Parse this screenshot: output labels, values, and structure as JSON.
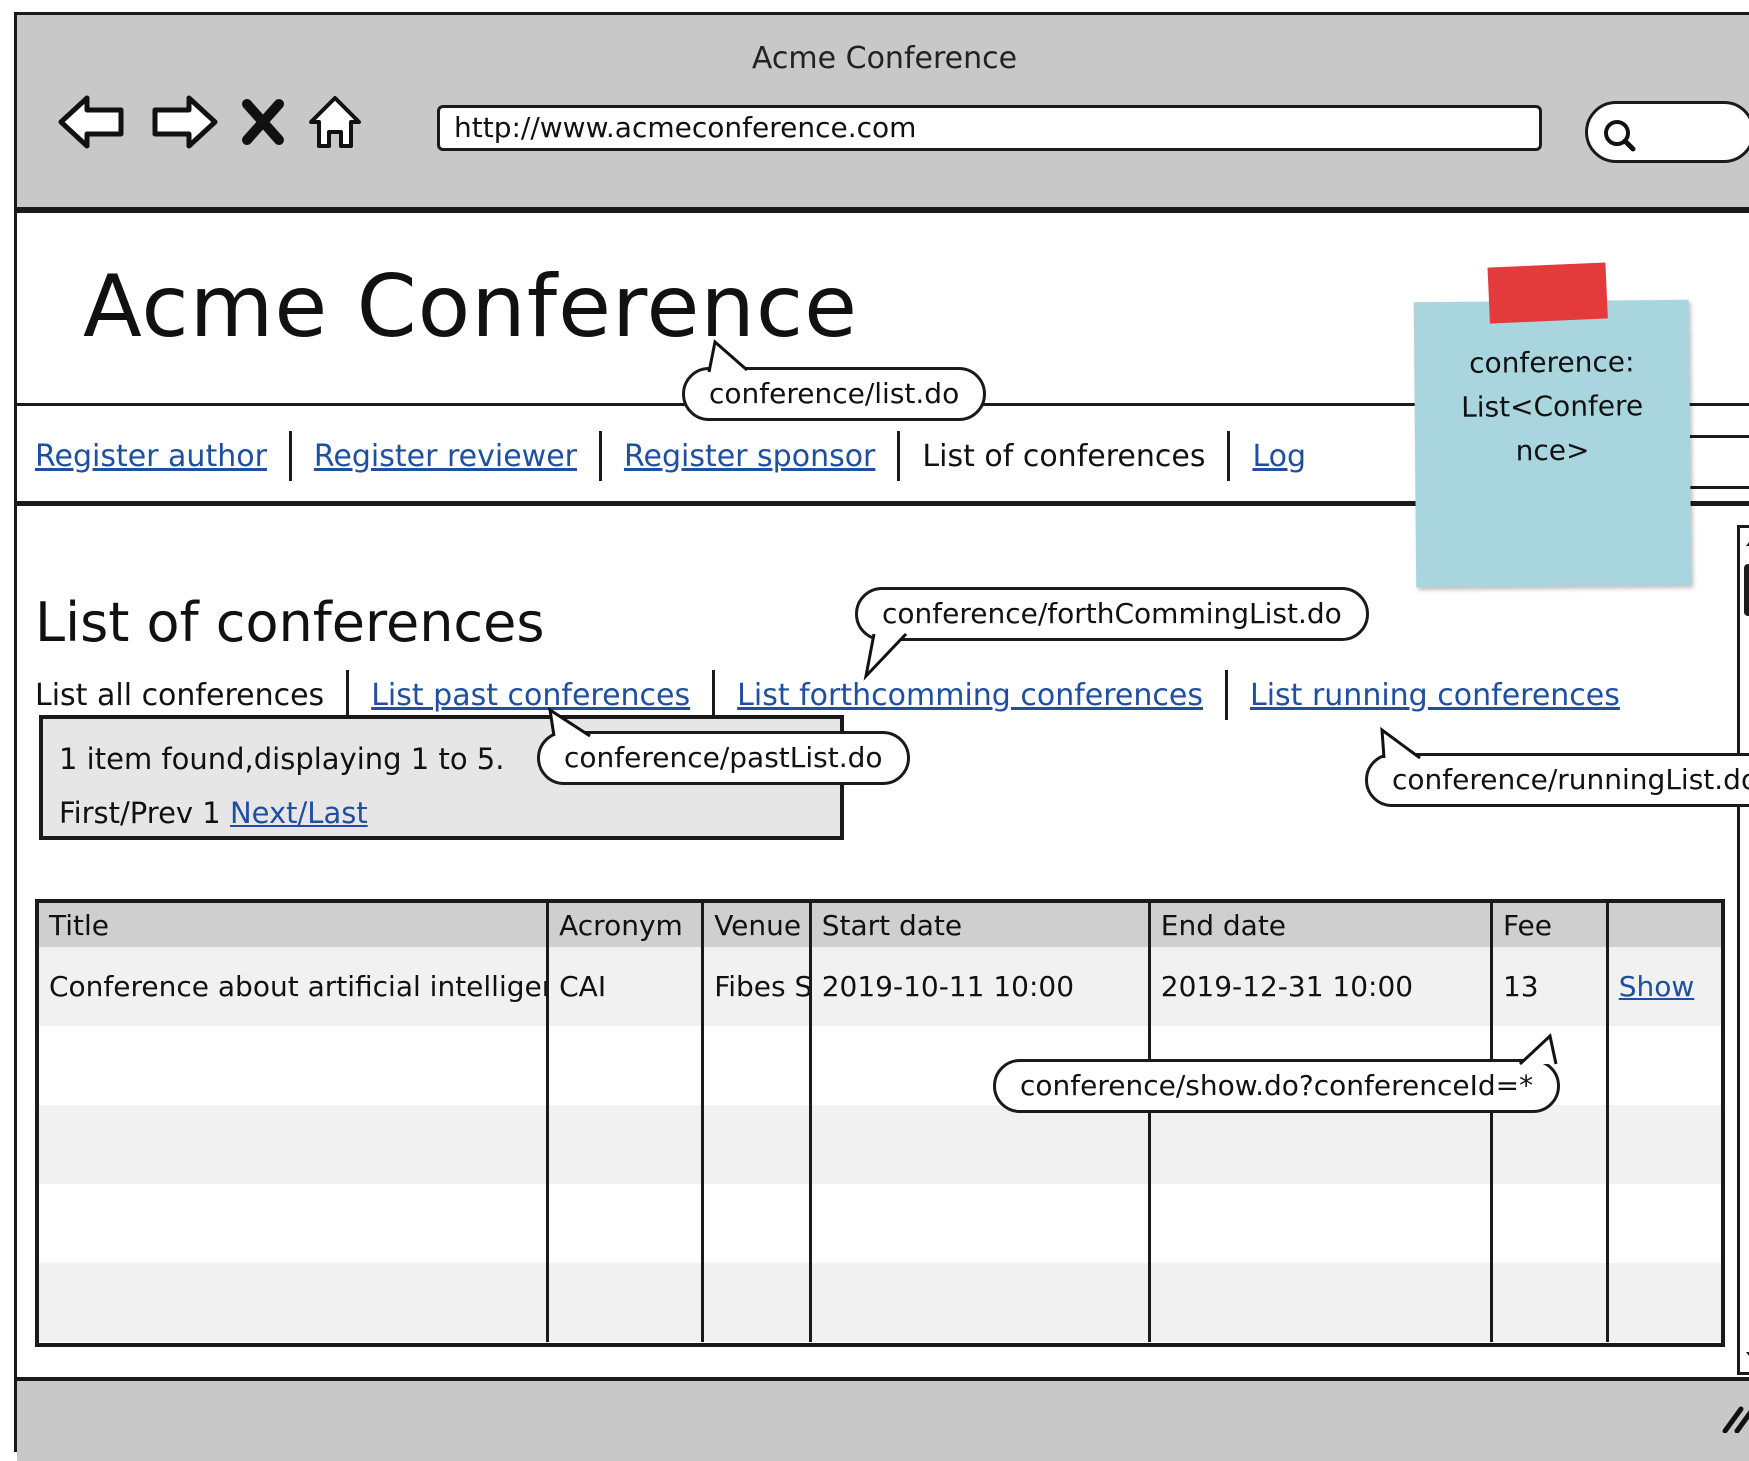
{
  "browser": {
    "window_title": "Acme Conference",
    "url": "http://www.acmeconference.com"
  },
  "header": {
    "site_title": "Acme Conference"
  },
  "menu": {
    "items": [
      {
        "label": "Register author",
        "link": true
      },
      {
        "label": "Register reviewer",
        "link": true
      },
      {
        "label": "Register sponsor",
        "link": true
      },
      {
        "label": "List of conferences",
        "link": false
      },
      {
        "label": "Log",
        "link": true
      }
    ]
  },
  "main": {
    "page_title": "List of conferences",
    "subnav": [
      {
        "label": "List all conferences",
        "link": false
      },
      {
        "label": "List past conferences",
        "link": true
      },
      {
        "label": "List forthcomming conferences",
        "link": true
      },
      {
        "label": "List running conferences",
        "link": true
      }
    ],
    "pagination": {
      "summary": "1 item found,displaying 1 to 5.",
      "first_prev": "First/Prev",
      "page": "1",
      "next_last": "Next/Last"
    },
    "table": {
      "headers": [
        "Title",
        "Acronym",
        "Venue",
        "Start date",
        "End date",
        "Fee",
        ""
      ],
      "rows": [
        {
          "title": "Conference about artificial intelligence",
          "acronym": "CAI",
          "venue": "Fibes Sevilla",
          "start_date": "2019-10-11 10:00",
          "end_date": "2019-12-31 10:00",
          "fee": "13",
          "action": "Show"
        }
      ]
    }
  },
  "annotations": {
    "list_do": "conference/list.do",
    "forth_list_do": "conference/forthCommingList.do",
    "past_list_do": "conference/pastList.do",
    "running_list_do": "conference/runningList.do",
    "show_do": "conference/show.do?conferenceId=*",
    "logout_callout": "",
    "sticky_note": [
      "conference:",
      "List<Confere",
      "nce>"
    ]
  },
  "colors": {
    "chrome": "#c8c8c8",
    "link": "#1e4fa0",
    "sticky": "#a9d5df",
    "tape": "#e33b3b",
    "table_header": "#cfcfcf",
    "info_box": "#e6e6e6"
  }
}
